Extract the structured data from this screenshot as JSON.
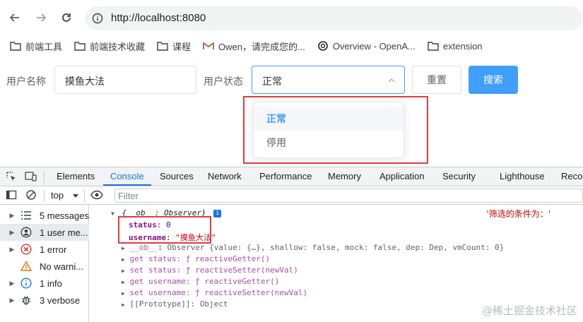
{
  "browser": {
    "url": "http://localhost:8080",
    "bookmarks": [
      {
        "label": "前端工具",
        "icon": "folder-icon"
      },
      {
        "label": "前端技术收藏",
        "icon": "folder-icon"
      },
      {
        "label": "课程",
        "icon": "folder-icon"
      },
      {
        "label": "Owen，请完成您的...",
        "icon": "gmail-icon"
      },
      {
        "label": "Overview - OpenA...",
        "icon": "openai-icon"
      },
      {
        "label": "extension",
        "icon": "folder-icon"
      }
    ]
  },
  "form": {
    "username_label": "用户名称",
    "username_value": "摸鱼大法",
    "status_label": "用户状态",
    "status_value": "正常",
    "reset_label": "重置",
    "search_label": "搜索",
    "status_options": [
      "正常",
      "停用"
    ]
  },
  "devtools": {
    "tabs": [
      "Elements",
      "Console",
      "Sources",
      "Network",
      "Performance",
      "Memory",
      "Application",
      "Security",
      "Lighthouse",
      "Recor"
    ],
    "active_tab": "Console",
    "context": "top",
    "filter_placeholder": "Filter",
    "sidebar": [
      {
        "label": "5 messages",
        "icon": "list-icon"
      },
      {
        "label": "1 user me...",
        "icon": "user-icon"
      },
      {
        "label": "1 error",
        "icon": "error-icon"
      },
      {
        "label": "No warni...",
        "icon": "warning-icon"
      },
      {
        "label": "1 info",
        "icon": "info-icon"
      },
      {
        "label": "3 verbose",
        "icon": "bug-icon"
      }
    ],
    "console": {
      "right_message": "'筛选的条件为：'",
      "object_header": "{__ob__: Observer}",
      "status_key": "status",
      "status_value": "0",
      "username_key": "username",
      "username_value": "\"摸鱼大法\"",
      "ob_line_key": "__ob__",
      "ob_line_value": "Observer {value: {…}, shallow: false, mock: false, dep: Dep, vmCount: 0}",
      "get_status": "get status: ƒ reactiveGetter()",
      "set_status": "set status: ƒ reactiveSetter(newVal)",
      "get_username": "get username: ƒ reactiveGetter()",
      "set_username": "set username: ƒ reactiveSetter(newVal)",
      "prototype": "[[Prototype]]: Object"
    }
  },
  "watermark": "@稀土掘金技术社区",
  "colors": {
    "primary": "#409eff",
    "highlight_box": "#e03c3c",
    "devtools_active": "#1a73e8"
  }
}
